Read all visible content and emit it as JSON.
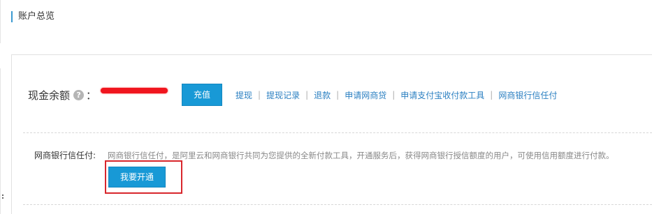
{
  "header": {
    "title": "账户总览"
  },
  "balance": {
    "label": "现金余额",
    "help_icon": "?",
    "colon": "：",
    "recharge_label": "充值"
  },
  "links": [
    {
      "label": "提现"
    },
    {
      "label": "提现记录"
    },
    {
      "label": "退款"
    },
    {
      "label": "申请网商贷"
    },
    {
      "label": "申请支付宝收付款工具"
    },
    {
      "label": "网商银行信任付"
    }
  ],
  "separator": "|",
  "credit": {
    "label": "网商银行信任付:",
    "description": "网商银行信任付，是阿里云和网商银行共同为您提供的全新付款工具，开通服务后，获得网商银行授信额度的用户，可使用信用额度进行付款。",
    "open_button_label": "我要开通"
  },
  "colors": {
    "primary_button": "#1899d6",
    "link": "#2a7fc1",
    "highlight_box": "#d8262c",
    "redaction": "#f0151e"
  }
}
